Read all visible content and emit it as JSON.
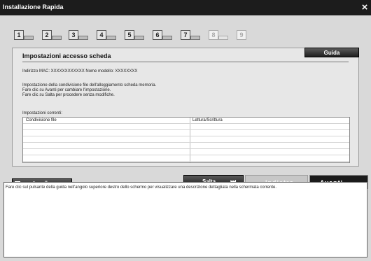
{
  "window": {
    "title": "Installazione Rapida",
    "close_glyph": "×"
  },
  "steps": [
    {
      "num": "1",
      "state": "active"
    },
    {
      "num": "2",
      "state": "active"
    },
    {
      "num": "3",
      "state": "active"
    },
    {
      "num": "4",
      "state": "active"
    },
    {
      "num": "5",
      "state": "active"
    },
    {
      "num": "6",
      "state": "active"
    },
    {
      "num": "7",
      "state": "active"
    },
    {
      "num": "8",
      "state": "dim"
    },
    {
      "num": "9",
      "state": "dim"
    }
  ],
  "panel": {
    "title": "Impostazioni accesso scheda",
    "help_button": "Guida",
    "info_line": "Indirizzo MAC: XXXXXXXXXXXX     Nome modello: XXXXXXXX",
    "description": [
      "Impostazione della condivisione file dell'alloggiamento scheda memoria.",
      "Fare clic su Avanti per cambiare l'impostazione.",
      "Fare clic su Salta per procedere senza modifiche."
    ],
    "current_label": "Impostazioni correnti:",
    "table_rows": [
      {
        "name": "Condivisione file",
        "value": "Lettura/Scrittura"
      },
      {
        "name": "",
        "value": ""
      },
      {
        "name": "",
        "value": ""
      },
      {
        "name": "",
        "value": ""
      },
      {
        "name": "",
        "value": ""
      },
      {
        "name": "",
        "value": ""
      },
      {
        "name": "",
        "value": ""
      }
    ]
  },
  "buttons": {
    "cancel": "Annulla",
    "skip": "Salta",
    "skip_icon": "⏭",
    "back": "Indietro",
    "back_icon": "←",
    "next": "Avanti",
    "next_icon": "→"
  },
  "help_text": "Fare clic sul pulsante della guida nell'angolo superiore destro dello schermo per visualizzare una descrizione dettagliata nella schermata corrente."
}
